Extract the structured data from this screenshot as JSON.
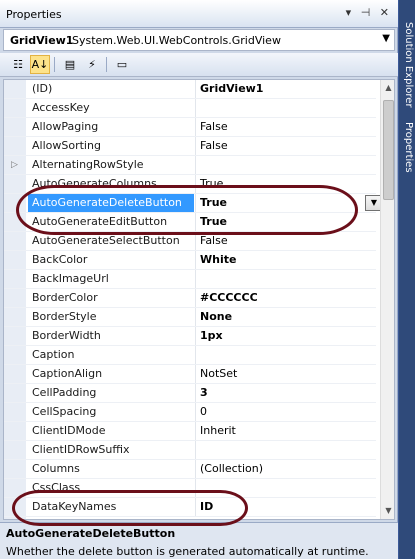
{
  "window": {
    "title": "Properties",
    "controls": "▾ ⊣ ✕"
  },
  "object_selector": {
    "name": "GridView1",
    "type": "System.Web.UI.WebControls.GridView"
  },
  "properties": [
    {
      "name": "(ID)",
      "value": "GridView1",
      "bold": true,
      "expander": false
    },
    {
      "name": "AccessKey",
      "value": "",
      "bold": false,
      "expander": false
    },
    {
      "name": "AllowPaging",
      "value": "False",
      "bold": false,
      "expander": false
    },
    {
      "name": "AllowSorting",
      "value": "False",
      "bold": false,
      "expander": false
    },
    {
      "name": "AlternatingRowStyle",
      "value": "",
      "bold": false,
      "expander": true
    },
    {
      "name": "AutoGenerateColumns",
      "value": "True",
      "bold": false,
      "expander": false
    },
    {
      "name": "AutoGenerateDeleteButton",
      "value": "True",
      "bold": true,
      "expander": false,
      "selected": true
    },
    {
      "name": "AutoGenerateEditButton",
      "value": "True",
      "bold": true,
      "expander": false
    },
    {
      "name": "AutoGenerateSelectButton",
      "value": "False",
      "bold": false,
      "expander": false
    },
    {
      "name": "BackColor",
      "value": "White",
      "bold": true,
      "expander": false
    },
    {
      "name": "BackImageUrl",
      "value": "",
      "bold": false,
      "expander": false
    },
    {
      "name": "BorderColor",
      "value": "#CCCCCC",
      "bold": true,
      "expander": false
    },
    {
      "name": "BorderStyle",
      "value": "None",
      "bold": true,
      "expander": false
    },
    {
      "name": "BorderWidth",
      "value": "1px",
      "bold": true,
      "expander": false
    },
    {
      "name": "Caption",
      "value": "",
      "bold": false,
      "expander": false
    },
    {
      "name": "CaptionAlign",
      "value": "NotSet",
      "bold": false,
      "expander": false
    },
    {
      "name": "CellPadding",
      "value": "3",
      "bold": true,
      "expander": false
    },
    {
      "name": "CellSpacing",
      "value": "0",
      "bold": false,
      "expander": false
    },
    {
      "name": "ClientIDMode",
      "value": "Inherit",
      "bold": false,
      "expander": false
    },
    {
      "name": "ClientIDRowSuffix",
      "value": "",
      "bold": false,
      "expander": false
    },
    {
      "name": "Columns",
      "value": "(Collection)",
      "bold": false,
      "expander": false
    },
    {
      "name": "CssClass",
      "value": "",
      "bold": false,
      "expander": false
    },
    {
      "name": "DataKeyNames",
      "value": "ID",
      "bold": true,
      "expander": false
    }
  ],
  "description": {
    "title": "AutoGenerateDeleteButton",
    "text": "Whether the delete button is generated automatically at runtime."
  },
  "side_tabs": [
    "Solution Explorer",
    "Properties"
  ],
  "colors": {
    "selection": "#3399ff",
    "annotation": "#6b0f1a"
  }
}
